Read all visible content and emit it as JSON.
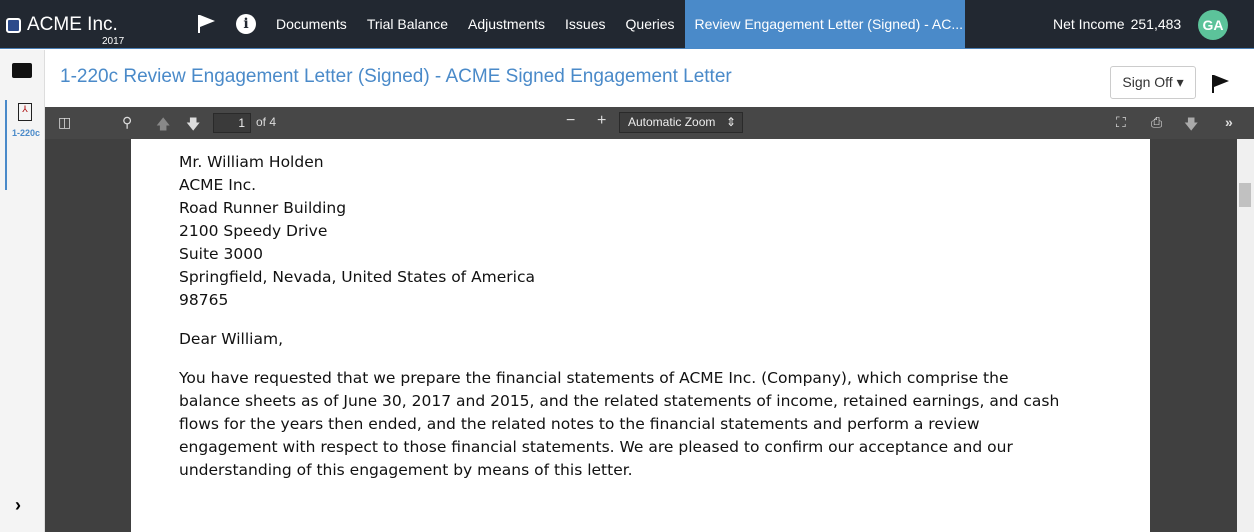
{
  "nav": {
    "company": "ACME Inc.",
    "year": "2017",
    "tabs": [
      "Documents",
      "Trial Balance",
      "Adjustments",
      "Issues",
      "Queries",
      "Review Engagement Letter (Signed) - AC..."
    ],
    "net_income_label": "Net Income",
    "net_income_value": "251,483",
    "avatar": "GA"
  },
  "sidebar": {
    "doc_label": "1-220c"
  },
  "header": {
    "title": "1-220c Review Engagement Letter (Signed) - ACME Signed Engagement Letter",
    "sign_off": "Sign Off ▾"
  },
  "toolbar": {
    "page": "1",
    "of": "of 4",
    "zoom": "Automatic Zoom"
  },
  "letter": {
    "address": [
      "Mr. William Holden",
      "ACME Inc.",
      "Road Runner Building",
      "2100 Speedy Drive",
      "Suite 3000",
      "Springfield, Nevada, United States of America",
      "98765"
    ],
    "greeting": "Dear William,",
    "body": "You have requested that we prepare the financial statements of ACME Inc. (Company), which comprise the balance sheets as of June 30, 2017 and 2015, and the related statements of income, retained earnings, and cash flows for the years then ended, and the related notes to the financial statements and perform a review engagement with respect to those financial statements. We are pleased to confirm our acceptance and our understanding of this engagement by means of this letter."
  }
}
